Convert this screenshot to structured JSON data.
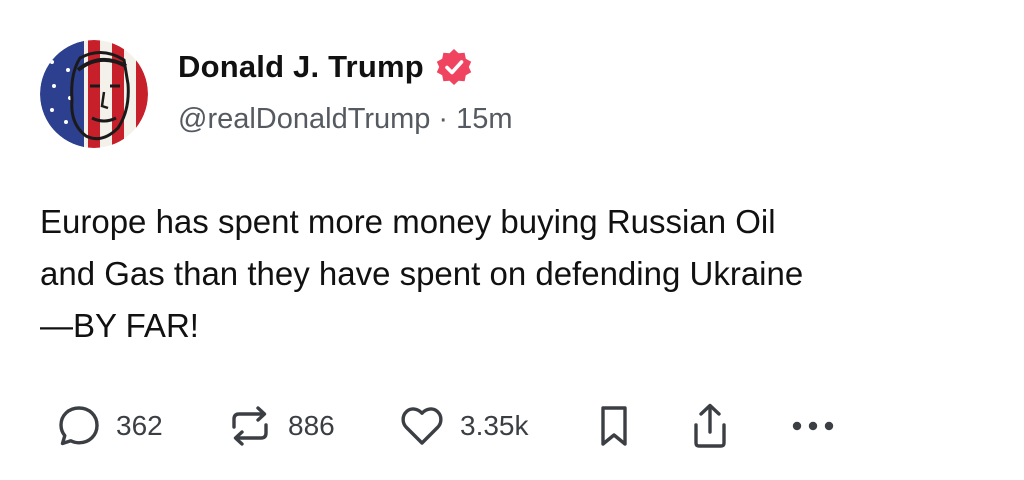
{
  "author": {
    "display_name": "Donald J. Trump",
    "handle": "@realDonaldTrump",
    "separator": "·",
    "time_ago": "15m",
    "verified_color": "#f0435f"
  },
  "post": {
    "text_lines": [
      "Europe has spent more money buying Russian Oil",
      "and Gas than they have spent on defending Ukraine",
      "—BY FAR!"
    ]
  },
  "actions": {
    "replies": {
      "icon": "reply-icon",
      "count": "362"
    },
    "reposts": {
      "icon": "repost-icon",
      "count": "886"
    },
    "likes": {
      "icon": "heart-icon",
      "count": "3.35k"
    },
    "bookmark": {
      "icon": "bookmark-icon"
    },
    "share": {
      "icon": "share-icon"
    },
    "more": {
      "icon": "more-icon"
    }
  },
  "colors": {
    "text": "#111111",
    "secondary_text": "#555a60",
    "icon": "#3b3f44"
  }
}
